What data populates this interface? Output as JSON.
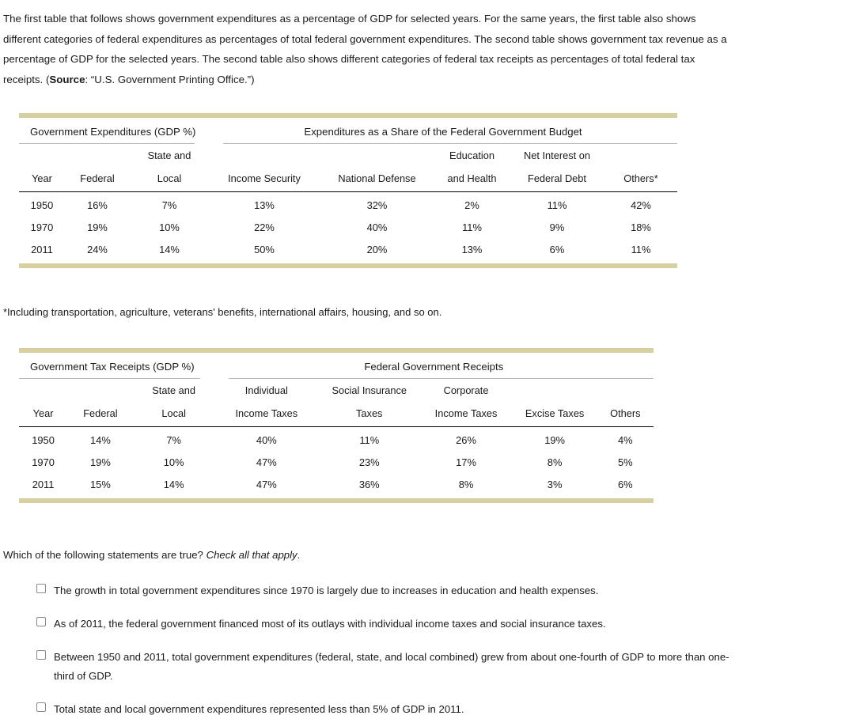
{
  "intro": {
    "part1": "The first table that follows shows government expenditures as a percentage of GDP for selected years. For the same years, the first table also shows different categories of federal expenditures as percentages of total federal government expenditures. The second table shows government tax revenue as a percentage of GDP for the selected years. The second table also shows different categories of federal tax receipts as percentages of total federal tax receipts. (",
    "source_label": "Source",
    "part2": ": “U.S. Government Printing Office.”)"
  },
  "table1": {
    "group_left": "Government Expenditures (GDP %)",
    "group_right": "Expenditures as a Share of the Federal Government Budget",
    "headers_top": [
      "",
      "",
      "State and",
      "",
      "",
      "Education",
      "Net Interest on",
      ""
    ],
    "headers_bottom": [
      "Year",
      "Federal",
      "Local",
      "Income Security",
      "National Defense",
      "and Health",
      "Federal Debt",
      "Others*"
    ],
    "rows": [
      [
        "1950",
        "16%",
        "7%",
        "13%",
        "32%",
        "2%",
        "11%",
        "42%"
      ],
      [
        "1970",
        "19%",
        "10%",
        "22%",
        "40%",
        "11%",
        "9%",
        "18%"
      ],
      [
        "2011",
        "24%",
        "14%",
        "50%",
        "20%",
        "13%",
        "6%",
        "11%"
      ]
    ]
  },
  "footnote": "*Including transportation, agriculture, veterans' benefits, international affairs, housing, and so on.",
  "table2": {
    "group_left": "Government Tax Receipts (GDP %)",
    "group_right": "Federal Government Receipts",
    "headers_top": [
      "",
      "",
      "State and",
      "Individual",
      "Social Insurance",
      "Corporate",
      "",
      ""
    ],
    "headers_bottom": [
      "Year",
      "Federal",
      "Local",
      "Income Taxes",
      "Taxes",
      "Income Taxes",
      "Excise Taxes",
      "Others"
    ],
    "rows": [
      [
        "1950",
        "14%",
        "7%",
        "40%",
        "11%",
        "26%",
        "19%",
        "4%"
      ],
      [
        "1970",
        "19%",
        "10%",
        "47%",
        "23%",
        "17%",
        "8%",
        "5%"
      ],
      [
        "2011",
        "15%",
        "14%",
        "47%",
        "36%",
        "8%",
        "3%",
        "6%"
      ]
    ]
  },
  "question": {
    "prompt": "Which of the following statements are true? ",
    "instruction": "Check all that apply",
    "period": ".",
    "options": [
      "The growth in total government expenditures since 1970 is largely due to increases in education and health expenses.",
      "As of 2011, the federal government financed most of its outlays with individual income taxes and social insurance taxes.",
      "Between 1950 and 2011, total government expenditures (federal, state, and local combined) grew from about one-fourth of GDP to more than one-third of GDP.",
      "Total state and local government expenditures represented less than 5% of GDP in 2011."
    ]
  },
  "colors": {
    "rule": "#d7cf9f",
    "text": "#1a1a1a",
    "thin_rule": "#b9b9b9"
  }
}
